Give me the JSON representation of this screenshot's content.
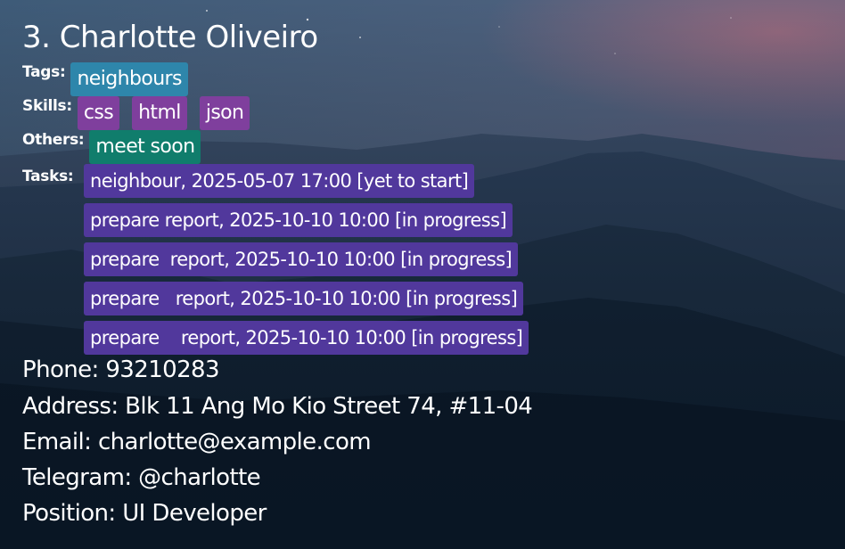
{
  "person": {
    "name": "3. Charlotte Oliveiro"
  },
  "tags": {
    "label": "Tags:",
    "items": [
      "neighbours"
    ]
  },
  "skills": {
    "label": "Skills:",
    "items": [
      "css",
      "html",
      "json"
    ]
  },
  "others": {
    "label": "Others:",
    "items": [
      "meet soon"
    ]
  },
  "tasks": {
    "label": "Tasks:",
    "items": [
      "neighbour, 2025-05-07 17:00 [yet to start]",
      "prepare report, 2025-10-10 10:00 [in progress]",
      "prepare  report, 2025-10-10 10:00 [in progress]",
      "prepare   report, 2025-10-10 10:00 [in progress]",
      "prepare    report, 2025-10-10 10:00 [in progress]"
    ]
  },
  "details": {
    "phone": "Phone: 93210283",
    "address": "Address: Blk 11 Ang Mo Kio Street 74, #11-04",
    "email": "Email: charlotte@example.com",
    "telegram": "Telegram: @charlotte",
    "position": "Position: UI Developer"
  },
  "colors": {
    "tag_chip": "#2e86ab",
    "skill_chip": "#7f3f9d",
    "other_chip": "#107d6c",
    "task_chip": "#51389c"
  }
}
